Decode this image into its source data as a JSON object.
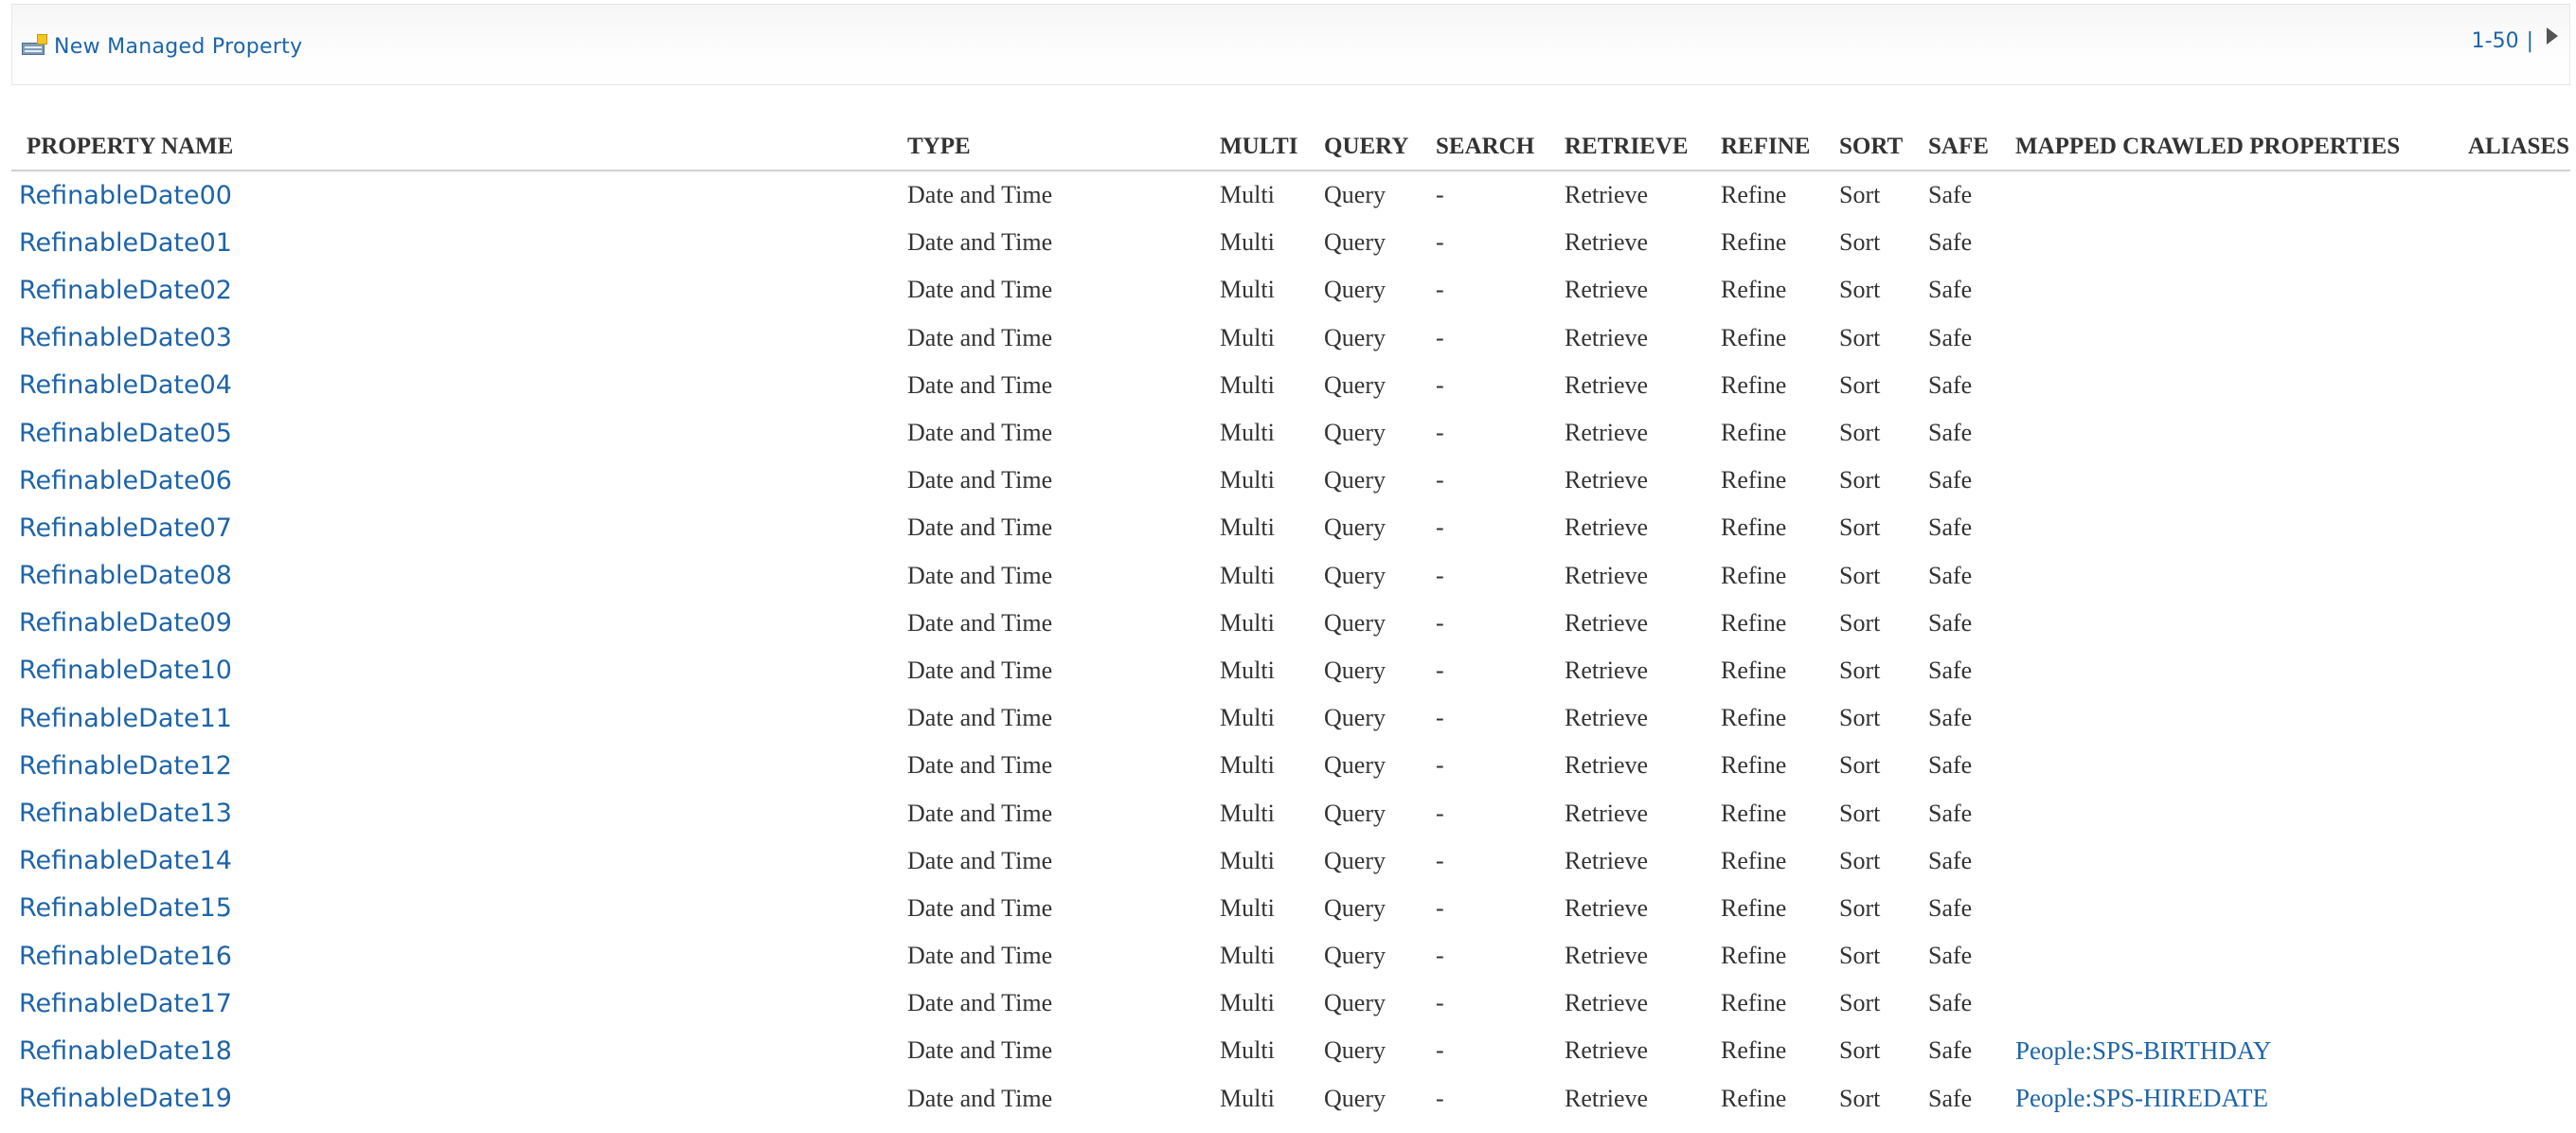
{
  "toolbar": {
    "new_label": "New Managed Property",
    "new_icon": "new-property-icon",
    "pager_range": "1-50",
    "pager_sep": "|",
    "next_icon": "next-page-arrow-icon"
  },
  "colors": {
    "link": "#1e64a8",
    "text": "#333333",
    "header_rule": "#d0d0d0"
  },
  "table": {
    "headers": [
      "PROPERTY NAME",
      "TYPE",
      "MULTI",
      "QUERY",
      "SEARCH",
      "RETRIEVE",
      "REFINE",
      "SORT",
      "SAFE",
      "MAPPED CRAWLED PROPERTIES",
      "ALIASES"
    ],
    "rows": [
      {
        "name": "RefinableDate00",
        "type": "Date and Time",
        "multi": "Multi",
        "query": "Query",
        "search": "-",
        "retrieve": "Retrieve",
        "refine": "Refine",
        "sort": "Sort",
        "safe": "Safe",
        "mapped": "",
        "aliases": ""
      },
      {
        "name": "RefinableDate01",
        "type": "Date and Time",
        "multi": "Multi",
        "query": "Query",
        "search": "-",
        "retrieve": "Retrieve",
        "refine": "Refine",
        "sort": "Sort",
        "safe": "Safe",
        "mapped": "",
        "aliases": ""
      },
      {
        "name": "RefinableDate02",
        "type": "Date and Time",
        "multi": "Multi",
        "query": "Query",
        "search": "-",
        "retrieve": "Retrieve",
        "refine": "Refine",
        "sort": "Sort",
        "safe": "Safe",
        "mapped": "",
        "aliases": ""
      },
      {
        "name": "RefinableDate03",
        "type": "Date and Time",
        "multi": "Multi",
        "query": "Query",
        "search": "-",
        "retrieve": "Retrieve",
        "refine": "Refine",
        "sort": "Sort",
        "safe": "Safe",
        "mapped": "",
        "aliases": ""
      },
      {
        "name": "RefinableDate04",
        "type": "Date and Time",
        "multi": "Multi",
        "query": "Query",
        "search": "-",
        "retrieve": "Retrieve",
        "refine": "Refine",
        "sort": "Sort",
        "safe": "Safe",
        "mapped": "",
        "aliases": ""
      },
      {
        "name": "RefinableDate05",
        "type": "Date and Time",
        "multi": "Multi",
        "query": "Query",
        "search": "-",
        "retrieve": "Retrieve",
        "refine": "Refine",
        "sort": "Sort",
        "safe": "Safe",
        "mapped": "",
        "aliases": ""
      },
      {
        "name": "RefinableDate06",
        "type": "Date and Time",
        "multi": "Multi",
        "query": "Query",
        "search": "-",
        "retrieve": "Retrieve",
        "refine": "Refine",
        "sort": "Sort",
        "safe": "Safe",
        "mapped": "",
        "aliases": ""
      },
      {
        "name": "RefinableDate07",
        "type": "Date and Time",
        "multi": "Multi",
        "query": "Query",
        "search": "-",
        "retrieve": "Retrieve",
        "refine": "Refine",
        "sort": "Sort",
        "safe": "Safe",
        "mapped": "",
        "aliases": ""
      },
      {
        "name": "RefinableDate08",
        "type": "Date and Time",
        "multi": "Multi",
        "query": "Query",
        "search": "-",
        "retrieve": "Retrieve",
        "refine": "Refine",
        "sort": "Sort",
        "safe": "Safe",
        "mapped": "",
        "aliases": ""
      },
      {
        "name": "RefinableDate09",
        "type": "Date and Time",
        "multi": "Multi",
        "query": "Query",
        "search": "-",
        "retrieve": "Retrieve",
        "refine": "Refine",
        "sort": "Sort",
        "safe": "Safe",
        "mapped": "",
        "aliases": ""
      },
      {
        "name": "RefinableDate10",
        "type": "Date and Time",
        "multi": "Multi",
        "query": "Query",
        "search": "-",
        "retrieve": "Retrieve",
        "refine": "Refine",
        "sort": "Sort",
        "safe": "Safe",
        "mapped": "",
        "aliases": ""
      },
      {
        "name": "RefinableDate11",
        "type": "Date and Time",
        "multi": "Multi",
        "query": "Query",
        "search": "-",
        "retrieve": "Retrieve",
        "refine": "Refine",
        "sort": "Sort",
        "safe": "Safe",
        "mapped": "",
        "aliases": ""
      },
      {
        "name": "RefinableDate12",
        "type": "Date and Time",
        "multi": "Multi",
        "query": "Query",
        "search": "-",
        "retrieve": "Retrieve",
        "refine": "Refine",
        "sort": "Sort",
        "safe": "Safe",
        "mapped": "",
        "aliases": ""
      },
      {
        "name": "RefinableDate13",
        "type": "Date and Time",
        "multi": "Multi",
        "query": "Query",
        "search": "-",
        "retrieve": "Retrieve",
        "refine": "Refine",
        "sort": "Sort",
        "safe": "Safe",
        "mapped": "",
        "aliases": ""
      },
      {
        "name": "RefinableDate14",
        "type": "Date and Time",
        "multi": "Multi",
        "query": "Query",
        "search": "-",
        "retrieve": "Retrieve",
        "refine": "Refine",
        "sort": "Sort",
        "safe": "Safe",
        "mapped": "",
        "aliases": ""
      },
      {
        "name": "RefinableDate15",
        "type": "Date and Time",
        "multi": "Multi",
        "query": "Query",
        "search": "-",
        "retrieve": "Retrieve",
        "refine": "Refine",
        "sort": "Sort",
        "safe": "Safe",
        "mapped": "",
        "aliases": ""
      },
      {
        "name": "RefinableDate16",
        "type": "Date and Time",
        "multi": "Multi",
        "query": "Query",
        "search": "-",
        "retrieve": "Retrieve",
        "refine": "Refine",
        "sort": "Sort",
        "safe": "Safe",
        "mapped": "",
        "aliases": ""
      },
      {
        "name": "RefinableDate17",
        "type": "Date and Time",
        "multi": "Multi",
        "query": "Query",
        "search": "-",
        "retrieve": "Retrieve",
        "refine": "Refine",
        "sort": "Sort",
        "safe": "Safe",
        "mapped": "",
        "aliases": ""
      },
      {
        "name": "RefinableDate18",
        "type": "Date and Time",
        "multi": "Multi",
        "query": "Query",
        "search": "-",
        "retrieve": "Retrieve",
        "refine": "Refine",
        "sort": "Sort",
        "safe": "Safe",
        "mapped": "People:SPS-BIRTHDAY",
        "aliases": ""
      },
      {
        "name": "RefinableDate19",
        "type": "Date and Time",
        "multi": "Multi",
        "query": "Query",
        "search": "-",
        "retrieve": "Retrieve",
        "refine": "Refine",
        "sort": "Sort",
        "safe": "Safe",
        "mapped": "People:SPS-HIREDATE",
        "aliases": ""
      }
    ]
  }
}
